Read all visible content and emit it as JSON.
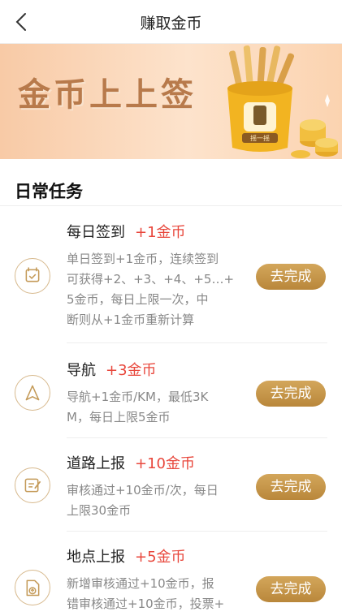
{
  "header": {
    "title": "赚取金币",
    "back_icon": "chevron-left-icon"
  },
  "banner": {
    "text": "金币上上签",
    "jar_label": "摇一摇"
  },
  "section": {
    "title": "日常任务"
  },
  "tasks": [
    {
      "name": "每日签到",
      "reward": "+1金币",
      "icon": "calendar-check-icon",
      "lines": [
        "单日签到+1金币，连续签到",
        "可获得+2、+3、+4、+5…+",
        "5金币，每日上限一次，中",
        "断则从+1金币重新计算"
      ],
      "button": "去完成"
    },
    {
      "name": "导航",
      "reward": "+3金币",
      "icon": "navigation-arrow-icon",
      "lines": [
        "导航+1金币/KM，最低3K",
        "M，每日上限5金币"
      ],
      "button": "去完成"
    },
    {
      "name": "道路上报",
      "reward": "+10金币",
      "icon": "edit-report-icon",
      "lines": [
        "审核通过+10金币/次，每日",
        "上限30金币"
      ],
      "button": "去完成"
    },
    {
      "name": "地点上报",
      "reward": "+5金币",
      "icon": "location-upload-icon",
      "lines": [
        "新增审核通过+10金币，报",
        "错审核通过+10金币，投票+"
      ],
      "button": "去完成"
    }
  ],
  "colors": {
    "accent": "#c4944a",
    "reward": "#e8473c",
    "desc": "#888888"
  }
}
